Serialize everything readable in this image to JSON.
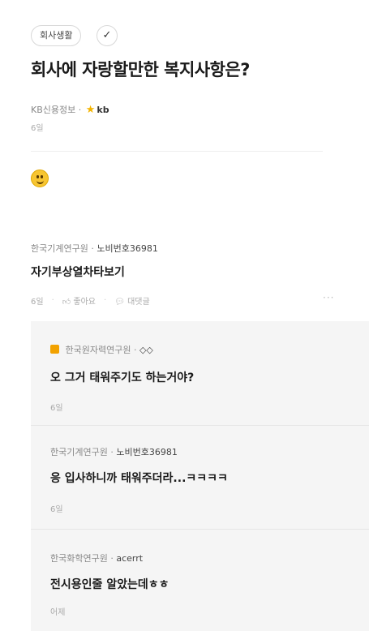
{
  "post": {
    "category_tag": "회사생활",
    "title": "회사에 자랑할만한 복지사항은?",
    "company": "KB신용정보",
    "author": "kb",
    "date": "6일",
    "body_emoji": "smiley"
  },
  "comment": {
    "company": "한국기계연구원",
    "author": "노비번호36981",
    "text": "자기부상열차타보기",
    "date": "6일",
    "like_label": "좋아요",
    "reply_label": "대댓글",
    "more": "···"
  },
  "replies": [
    {
      "company": "한국원자력연구원",
      "author": "◇◇",
      "text": "오 그거 태워주기도 하는거야?",
      "date": "6일",
      "badge": true
    },
    {
      "company": "한국기계연구원",
      "author": "노비번호36981",
      "text": "응 입사하니까 태워주더라...ㅋㅋㅋㅋ",
      "date": "6일",
      "badge": false
    },
    {
      "company": "한국화학연구원",
      "author": "acerrt",
      "text": "전시용인줄 알았는데ㅎㅎ",
      "date": "어제",
      "badge": false
    }
  ]
}
